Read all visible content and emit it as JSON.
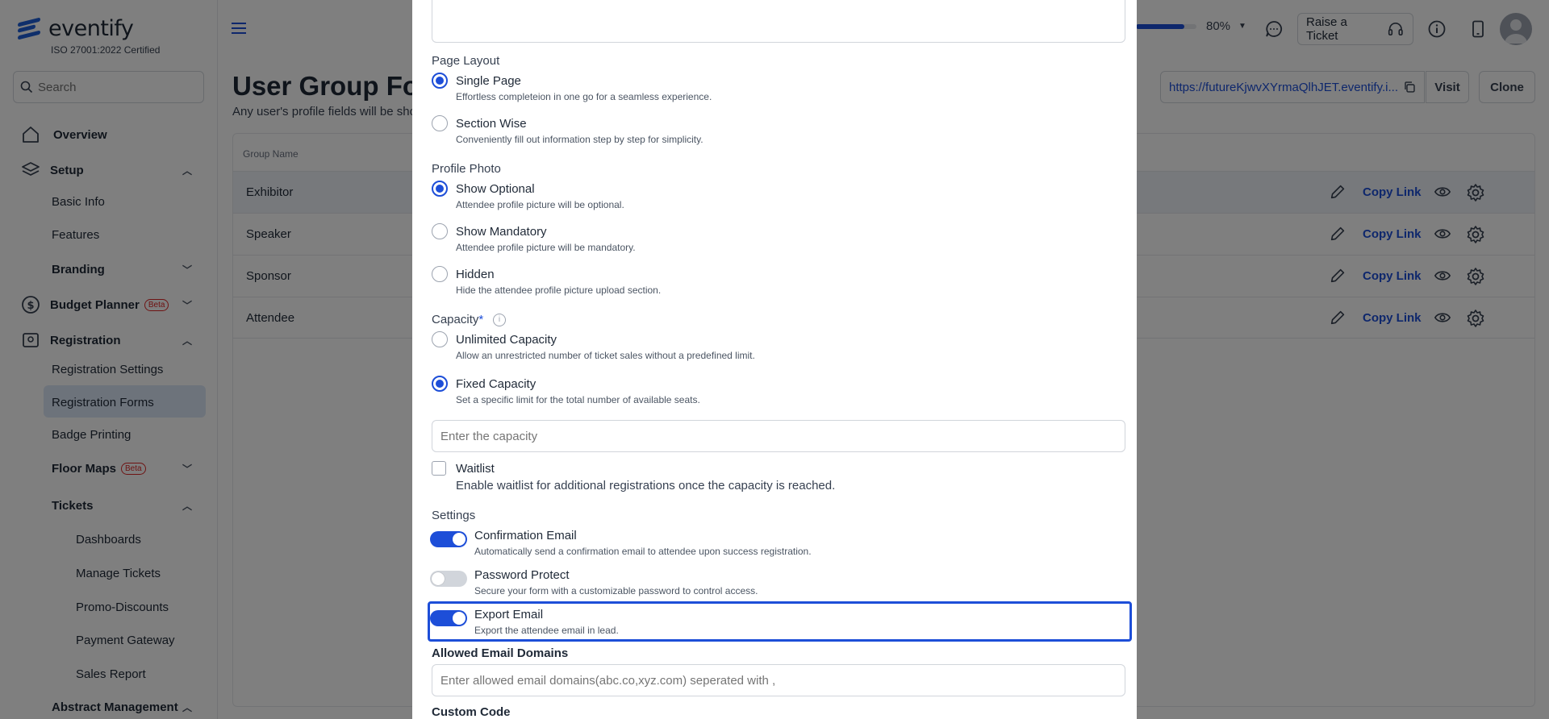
{
  "sidebar": {
    "logo_text": "eventify",
    "certification": "ISO 27001:2022 Certified",
    "search_placeholder": "Search",
    "items": {
      "overview": "Overview",
      "setup": "Setup",
      "basic_info": "Basic Info",
      "features": "Features",
      "branding": "Branding",
      "budget_planner": "Budget Planner",
      "budget_badge": "Beta",
      "registration": "Registration",
      "registration_settings": "Registration Settings",
      "registration_forms": "Registration Forms",
      "badge_printing": "Badge Printing",
      "floor_maps": "Floor Maps",
      "floor_badge": "Beta",
      "tickets": "Tickets",
      "dashboards": "Dashboards",
      "manage_tickets": "Manage Tickets",
      "promo_discounts": "Promo-Discounts",
      "payment_gateway": "Payment Gateway",
      "sales_report": "Sales Report",
      "abstract_management": "Abstract Management"
    }
  },
  "header": {
    "progress_percent": 80,
    "progress_label": "80%",
    "raise_ticket": "Raise a Ticket"
  },
  "page": {
    "title": "User Group Form",
    "subtitle": "Any user's profile fields will be sho",
    "url": "https://futureKjwvXYrmaQlhJET.eventify.i...",
    "visit": "Visit",
    "clone": "Clone",
    "table_header": "Group Name",
    "copy_link": "Copy Link",
    "rows": [
      "Exhibitor",
      "Speaker",
      "Sponsor",
      "Attendee"
    ]
  },
  "panel": {
    "page_layout_label": "Page Layout",
    "single_page": "Single Page",
    "single_page_desc": "Effortless completeion in one go for a seamless experience.",
    "section_wise": "Section Wise",
    "section_wise_desc": "Conveniently fill out information step by step for simplicity.",
    "profile_photo_label": "Profile Photo",
    "show_optional": "Show Optional",
    "show_optional_desc": "Attendee profile picture will be optional.",
    "show_mandatory": "Show Mandatory",
    "show_mandatory_desc": "Attendee profile picture will be mandatory.",
    "hidden": "Hidden",
    "hidden_desc": "Hide the attendee profile picture upload section.",
    "capacity_label": "Capacity",
    "capacity_required": "*",
    "unlimited": "Unlimited Capacity",
    "unlimited_desc": "Allow an unrestricted number of ticket sales without a predefined limit.",
    "fixed": "Fixed Capacity",
    "fixed_desc": "Set a specific limit for the total number of available seats.",
    "capacity_placeholder": "Enter the capacity",
    "waitlist": "Waitlist",
    "waitlist_desc": "Enable waitlist for additional registrations once the capacity is reached.",
    "settings_label": "Settings",
    "confirmation_email": "Confirmation Email",
    "confirmation_email_desc": "Automatically send a confirmation email to attendee upon success registration.",
    "password_protect": "Password Protect",
    "password_protect_desc": "Secure your form with a customizable password to control access.",
    "export_email": "Export Email",
    "export_email_desc": "Export the attendee email in lead.",
    "allowed_domains_label": "Allowed Email Domains",
    "allowed_domains_placeholder": "Enter allowed email domains(abc.co,xyz.com) seperated with ,",
    "custom_code_label": "Custom Code"
  },
  "colors": {
    "accent": "#1d4ed8",
    "overlay": "rgba(0,0,0,0.5)",
    "active_nav": "#dbe6f7"
  }
}
